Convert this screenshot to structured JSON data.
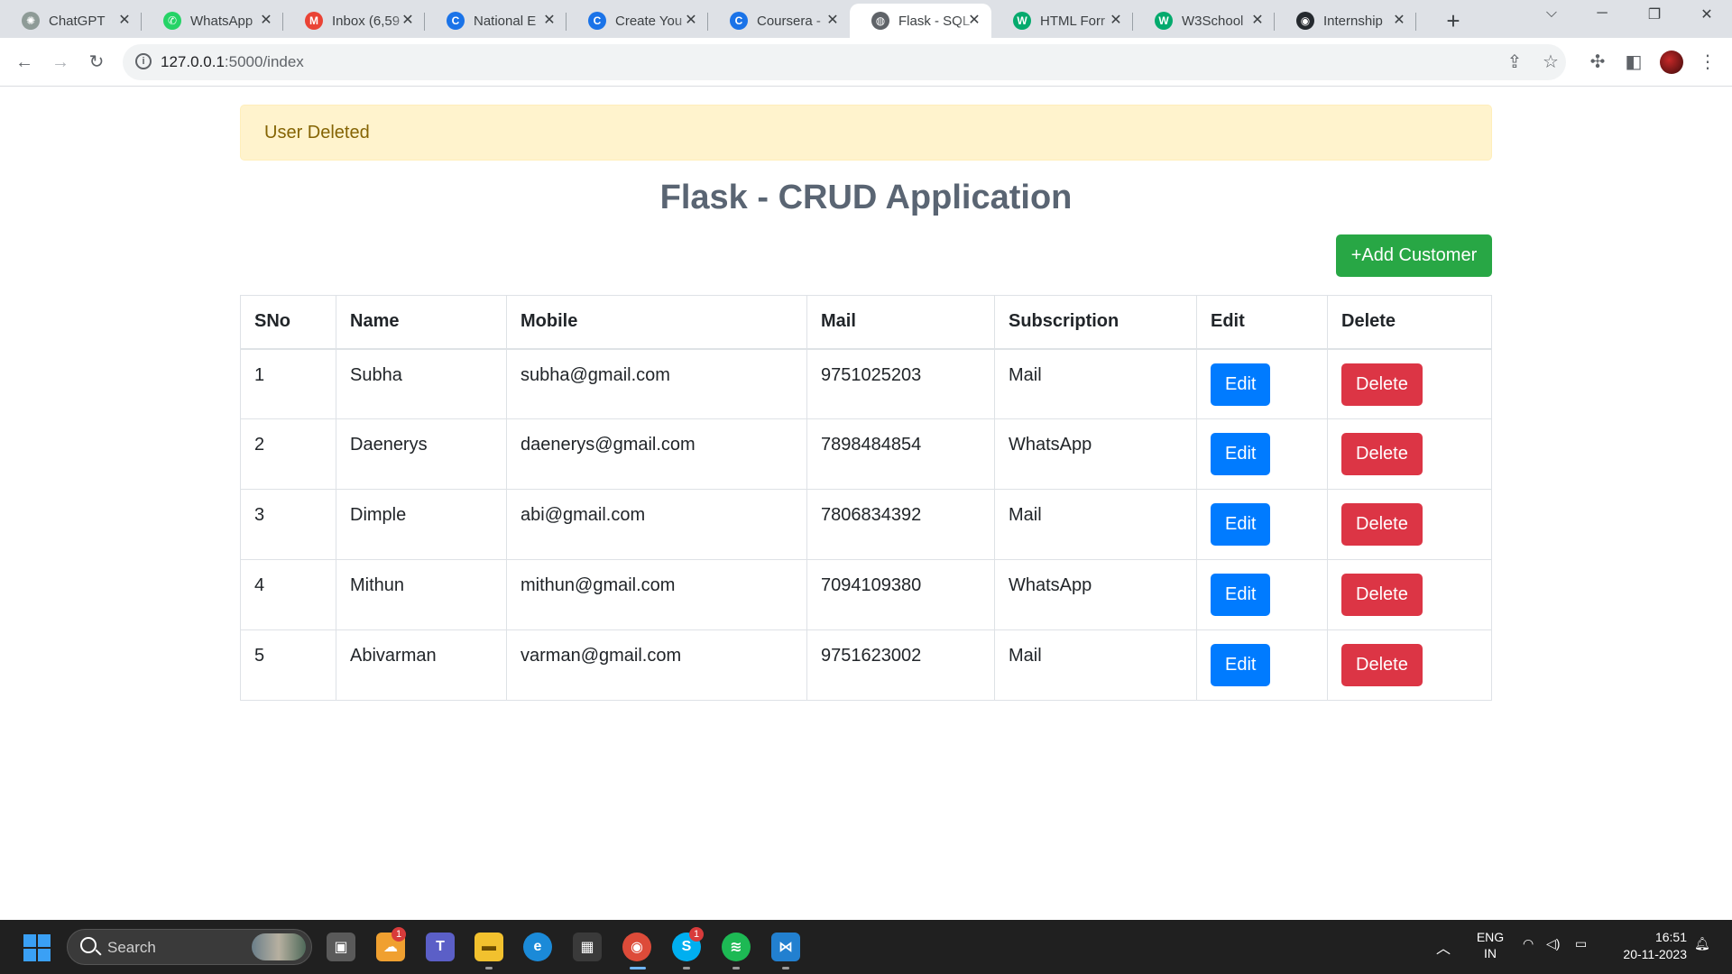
{
  "browser": {
    "tabs": [
      {
        "title": "ChatGPT",
        "icon": "chatgpt-icon",
        "color": "#8e9b97",
        "glyph": "✺"
      },
      {
        "title": "WhatsApp",
        "icon": "whatsapp-icon",
        "color": "#25d366",
        "glyph": "✆"
      },
      {
        "title": "Inbox (6,59",
        "icon": "gmail-icon",
        "color": "#ea4335",
        "glyph": "M"
      },
      {
        "title": "National E",
        "icon": "course-icon",
        "color": "#1a73e8",
        "glyph": "C"
      },
      {
        "title": "Create You",
        "icon": "course-icon",
        "color": "#1a73e8",
        "glyph": "C"
      },
      {
        "title": "Coursera -",
        "icon": "coursera-icon",
        "color": "#1a73e8",
        "glyph": "C"
      },
      {
        "title": "Flask - SQL",
        "icon": "globe-icon",
        "color": "#5f6368",
        "glyph": "◍"
      },
      {
        "title": "HTML Forr",
        "icon": "w3schools-icon",
        "color": "#04aa6d",
        "glyph": "W"
      },
      {
        "title": "W3School",
        "icon": "w3schools-icon",
        "color": "#04aa6d",
        "glyph": "W"
      },
      {
        "title": "Internship",
        "icon": "github-icon",
        "color": "#24292e",
        "glyph": "◉"
      }
    ],
    "active_tab": 6,
    "address": {
      "host": "127.0.0.1",
      "path": ":5000/index"
    }
  },
  "page": {
    "alert": "User Deleted",
    "title": "Flask - CRUD Application",
    "add_button": "+Add Customer",
    "table": {
      "headers": [
        "SNo",
        "Name",
        "Mobile",
        "Mail",
        "Subscription",
        "Edit",
        "Delete"
      ],
      "rows": [
        {
          "sno": "1",
          "name": "Subha",
          "mobile": "subha@gmail.com",
          "mail": "9751025203",
          "subscription": "Mail"
        },
        {
          "sno": "2",
          "name": "Daenerys",
          "mobile": "daenerys@gmail.com",
          "mail": "7898484854",
          "subscription": "WhatsApp"
        },
        {
          "sno": "3",
          "name": "Dimple",
          "mobile": "abi@gmail.com",
          "mail": "7806834392",
          "subscription": "Mail"
        },
        {
          "sno": "4",
          "name": "Mithun",
          "mobile": "mithun@gmail.com",
          "mail": "7094109380",
          "subscription": "WhatsApp"
        },
        {
          "sno": "5",
          "name": "Abivarman",
          "mobile": "varman@gmail.com",
          "mail": "9751623002",
          "subscription": "Mail"
        }
      ],
      "edit_label": "Edit",
      "delete_label": "Delete"
    }
  },
  "taskbar": {
    "search_label": "Search",
    "language": {
      "line1": "ENG",
      "line2": "IN"
    },
    "time": "16:51",
    "date": "20-11-2023",
    "badges": {
      "weather": "1",
      "skype": "1"
    }
  },
  "colors": {
    "success": "#28a745",
    "primary": "#007bff",
    "danger": "#dc3545",
    "alert_bg": "#fff3cd"
  }
}
